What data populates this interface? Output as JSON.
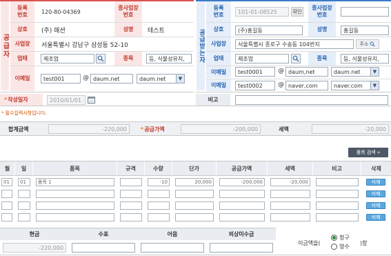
{
  "supplier": {
    "side_label": "공급자",
    "reg_no_label": "등록\n번호",
    "reg_no": "120-80-04369",
    "branch_label": "종사업장\n번호",
    "branch_no": "",
    "company_label": "상호",
    "company": "(주) 패션",
    "name_label": "성명",
    "name": "테스트",
    "address_label": "사업장",
    "address": "서울특별시 강남구 삼성동 52-10",
    "biztype_label": "업태",
    "biztype": "제조업",
    "item_label": "종목",
    "item": "등, 식물성유지,",
    "email_label": "이메일",
    "email_user": "test001",
    "email_at": "@",
    "email_domain": "daum.net",
    "email_select": "daum.net"
  },
  "buyer": {
    "side_label": "공급받는자",
    "reg_no_label": "등록\n번호",
    "reg_no": "101-01-08525",
    "confirm_label": "확인",
    "branch_label": "종사업장\n번호",
    "branch_no": "",
    "company_label": "상호",
    "company": "(주)홍길동",
    "name_label": "성명",
    "name": "홍길동",
    "address_label": "사업장",
    "address": "서울특별시 종로구 수송동 104번지",
    "address_btn": "주소",
    "biztype_label": "업태",
    "biztype": "제조업",
    "item_label": "종목",
    "item": "등, 식물성유지,",
    "email1_label": "이메일",
    "email1_user": "test0001",
    "email1_at": "@",
    "email1_domain": "daum,net",
    "email1_select": "daum.net",
    "email2_label": "이메일",
    "email2_user": "test0002",
    "email2_at": "@",
    "email2_domain": "naver,com",
    "email2_select": "naver.com"
  },
  "date": {
    "label": "작성일자",
    "value": "2010/01/01",
    "note_label": "비고",
    "note_value": ""
  },
  "required_notice": "필수입력사항입니다.",
  "totals": {
    "sum_label": "합계금액",
    "sum_value": "-220,000",
    "supply_label": "공급가액",
    "supply_value": "-200,000",
    "tax_label": "세액",
    "tax_value": "-20,000"
  },
  "item_search_btn": "품목 검색 »",
  "grid": {
    "headers": [
      "월",
      "일",
      "품목",
      "규격",
      "수량",
      "단가",
      "공급가액",
      "세액",
      "비고",
      "삭제"
    ],
    "rows": [
      {
        "month": "01",
        "day": "01",
        "item": "품목 1",
        "spec": "",
        "qty": "-10",
        "price": "20,000",
        "supply": "-200,000",
        "tax": "-20,000",
        "note": "",
        "del": "삭제"
      },
      {
        "month": "",
        "day": "",
        "item": "",
        "spec": "",
        "qty": "",
        "price": "",
        "supply": "",
        "tax": "",
        "note": "",
        "del": "삭제"
      },
      {
        "month": "",
        "day": "",
        "item": "",
        "spec": "",
        "qty": "",
        "price": "",
        "supply": "",
        "tax": "",
        "note": "",
        "del": "삭제"
      },
      {
        "month": "",
        "day": "",
        "item": "",
        "spec": "",
        "qty": "",
        "price": "",
        "supply": "",
        "tax": "",
        "note": "",
        "del": "삭제"
      }
    ]
  },
  "payment": {
    "cash_label": "현금",
    "cash_value": "-220,000",
    "check_label": "수표",
    "check_value": "",
    "bill_label": "어음",
    "bill_value": "",
    "credit_label": "외상미수금",
    "credit_value": "",
    "amount_text_prefix": "이금액을(",
    "amount_text_suffix": ")함",
    "option_claim": "청구",
    "option_receipt": "영수",
    "selected": "청구"
  }
}
